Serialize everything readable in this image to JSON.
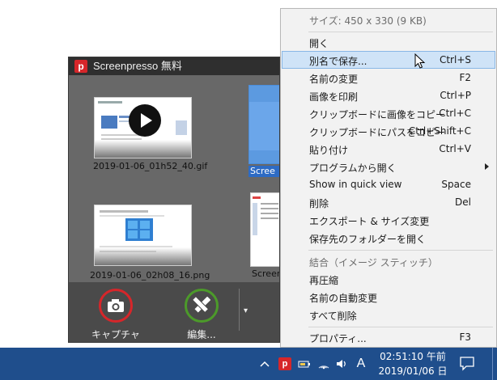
{
  "window": {
    "title": "Screenpresso 無料",
    "logo_letter": "p"
  },
  "thumbnails": [
    {
      "label": "2019-01-06_01h52_40.gif",
      "selected": false,
      "has_play": true
    },
    {
      "label": "Scree",
      "selected": true,
      "has_play": false
    },
    {
      "label": "2019-01-06_02h08_16.png",
      "selected": false,
      "has_play": false
    },
    {
      "label": "Screen",
      "selected": false,
      "has_play": false
    }
  ],
  "toolbar": {
    "capture_label": "キャプチャ",
    "edit_label": "編集...",
    "more_glyph": "▾"
  },
  "menu": {
    "size_info": "サイズ: 450 x 330 (9 KB)",
    "items": [
      {
        "label": "開く",
        "shortcut": ""
      },
      {
        "label": "別名で保存...",
        "shortcut": "Ctrl+S"
      },
      {
        "label": "名前の変更",
        "shortcut": "F2"
      },
      {
        "label": "画像を印刷",
        "shortcut": "Ctrl+P"
      },
      {
        "label": "クリップボードに画像をコピー",
        "shortcut": "Ctrl+C"
      },
      {
        "label": "クリップボードにパスをコピー",
        "shortcut": "Ctrl+Shift+C"
      },
      {
        "label": "貼り付け",
        "shortcut": "Ctrl+V"
      },
      {
        "label": "プログラムから開く",
        "shortcut": ""
      },
      {
        "label": "Show in quick view",
        "shortcut": "Space"
      },
      {
        "label": "削除",
        "shortcut": "Del"
      },
      {
        "label": "エクスポート & サイズ変更",
        "shortcut": ""
      },
      {
        "label": "保存先のフォルダーを開く",
        "shortcut": ""
      },
      {
        "label": "結合（イメージ スティッチ）",
        "shortcut": ""
      },
      {
        "label": "再圧縮",
        "shortcut": ""
      },
      {
        "label": "名前の自動変更",
        "shortcut": ""
      },
      {
        "label": "すべて削除",
        "shortcut": ""
      },
      {
        "label": "プロパティ...",
        "shortcut": "F3"
      }
    ]
  },
  "taskbar": {
    "ime_label": "A",
    "time": "02:51:10 午前",
    "date": "2019/01/06 日"
  },
  "colors": {
    "highlight": "#cfe3f7",
    "capture_ring": "#d6262a",
    "edit_ring": "#4c9a2a",
    "taskbar": "#1f4e8c"
  }
}
